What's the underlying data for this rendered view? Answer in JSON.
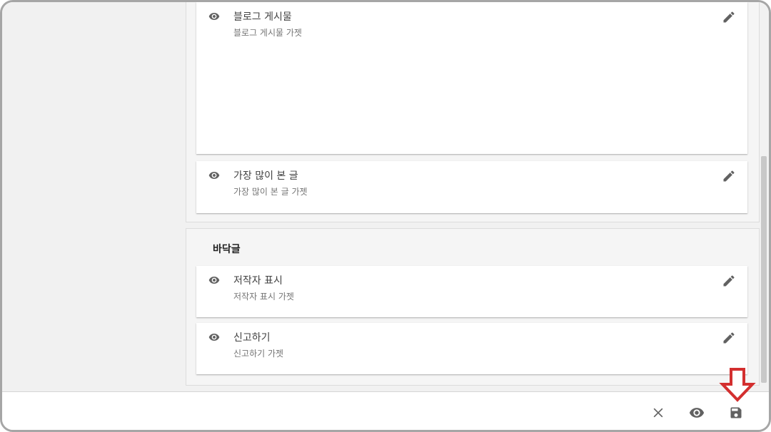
{
  "sections": [
    {
      "title": "",
      "cards": [
        {
          "title": "블로그 게시물",
          "subtitle": "블로그 게시물 가젯"
        },
        {
          "title": "가장 많이 본 글",
          "subtitle": "가장 많이 본 글 가젯"
        }
      ]
    },
    {
      "title": "바닥글",
      "cards": [
        {
          "title": "저작자 표시",
          "subtitle": "저작자 표시 가젯"
        },
        {
          "title": "신고하기",
          "subtitle": "신고하기 가젯"
        }
      ]
    }
  ],
  "bottom_bar": {
    "icons": [
      "close-icon",
      "eye-icon",
      "save-icon"
    ]
  },
  "annotation": {
    "icon": "arrow-down-icon",
    "color": "#d32f2f"
  },
  "colors": {
    "icon": "#616161",
    "canvas": "#f1f1f1"
  }
}
